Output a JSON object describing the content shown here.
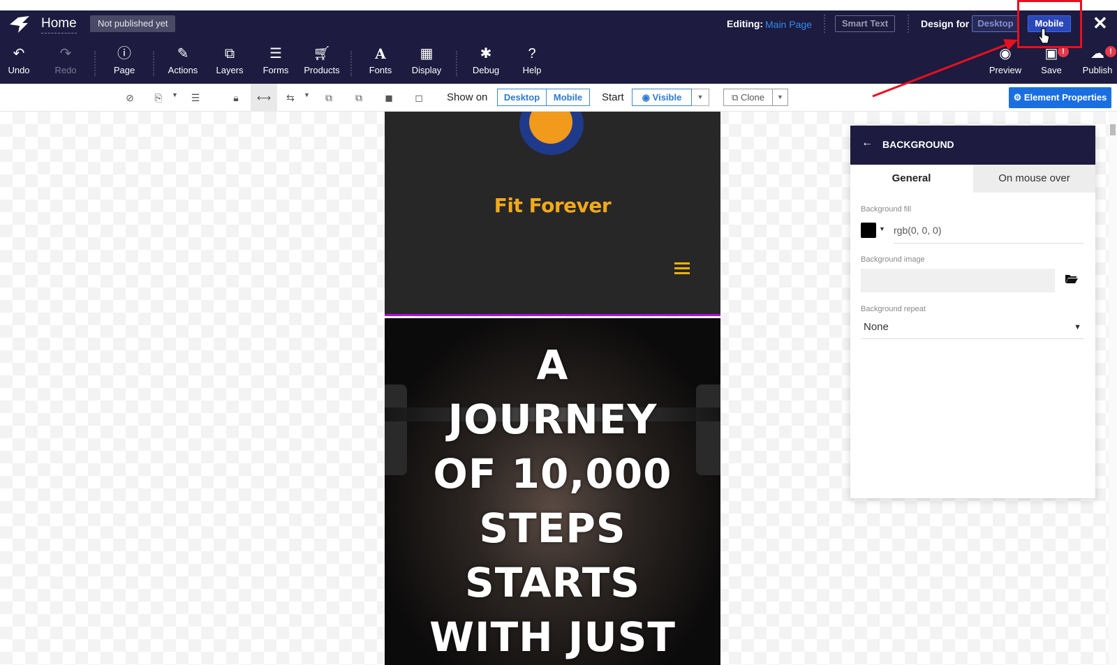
{
  "header": {
    "page_title": "Home",
    "status_badge": "Not published yet",
    "editing_label": "Editing:",
    "editing_value": "Main Page",
    "smart_text": "Smart Text",
    "design_for_label": "Design for",
    "design_desktop": "Desktop",
    "design_mobile": "Mobile"
  },
  "toolbar": {
    "left": [
      {
        "label": "Undo",
        "icon": "undo-icon"
      },
      {
        "label": "Redo",
        "icon": "redo-icon"
      },
      {
        "label": "Page",
        "icon": "info-icon"
      },
      {
        "label": "Actions",
        "icon": "magic-wand-icon"
      },
      {
        "label": "Layers",
        "icon": "layers-icon"
      },
      {
        "label": "Forms",
        "icon": "list-icon"
      },
      {
        "label": "Products",
        "icon": "cart-icon"
      },
      {
        "label": "Fonts",
        "icon": "font-icon"
      },
      {
        "label": "Display",
        "icon": "grid-icon"
      },
      {
        "label": "Debug",
        "icon": "bug-icon"
      },
      {
        "label": "Help",
        "icon": "question-icon"
      }
    ],
    "right": [
      {
        "label": "Preview",
        "icon": "eye-icon"
      },
      {
        "label": "Save",
        "icon": "floppy-icon"
      },
      {
        "label": "Publish",
        "icon": "cloud-upload-icon"
      }
    ],
    "notice": "!"
  },
  "subbar": {
    "show_on_label": "Show on",
    "show_desktop": "Desktop",
    "show_mobile": "Mobile",
    "start_label": "Start",
    "visible_label": "Visible",
    "clone_label": "Clone",
    "element_properties": "Element Properties"
  },
  "site": {
    "title": "Fit Forever",
    "hero_lines": [
      "A",
      "JOURNEY",
      "OF 10,000",
      "STEPS",
      "STARTS",
      "WITH JUST"
    ]
  },
  "panel": {
    "title": "BACKGROUND",
    "tab_general": "General",
    "tab_hover": "On mouse over",
    "fill_label": "Background fill",
    "fill_value": "rgb(0, 0, 0)",
    "image_label": "Background image",
    "repeat_label": "Background repeat",
    "repeat_value": "None"
  },
  "colors": {
    "header_bg": "#1d1b3f",
    "accent_blue": "#1a6fe0",
    "highlight_red": "#e8101f",
    "site_title": "#f2a91b",
    "header_border": "#b00fd8"
  }
}
